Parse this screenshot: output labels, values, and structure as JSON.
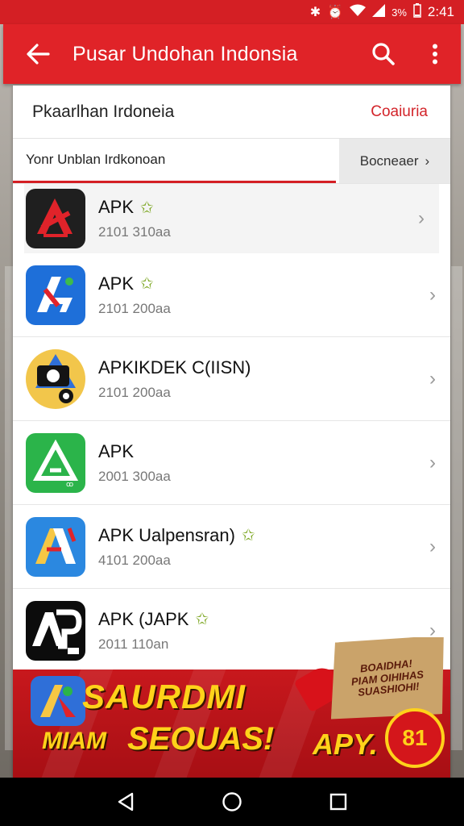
{
  "status_bar": {
    "battery": "3%",
    "time": "2:41"
  },
  "app_bar": {
    "title": "Pusar Undohan Indonsia"
  },
  "card": {
    "title": "Pkaarlhan Irdoneia",
    "action": "Coaiuria"
  },
  "search": {
    "value": "Yonr Unblan Irdkonoan",
    "button_label": "Bocneaer"
  },
  "apps": [
    {
      "name": "APK",
      "meta": "2101 310aa",
      "starred": true,
      "icon_color": "#1f1f1f"
    },
    {
      "name": "APK",
      "meta": "2101 200aa",
      "starred": true,
      "icon_color": "#1e6fd9"
    },
    {
      "name": "APKIKDEK C(IISN)",
      "meta": "2101 200aa",
      "starred": false,
      "icon_color": "#f2c64b"
    },
    {
      "name": "APK",
      "meta": "2001 300aa",
      "starred": false,
      "icon_color": "#2bb44a"
    },
    {
      "name": "APK Ualpensran)",
      "meta": "4101 200aa",
      "starred": true,
      "icon_color": "#2b88e0"
    },
    {
      "name": "APK (JAPK",
      "meta": "2011 110an",
      "starred": true,
      "icon_color": "#0c0c0c"
    }
  ],
  "promo": {
    "headline": "SAURDMI",
    "line_left": "MIAM",
    "line_right": "SEOUAS!",
    "sign_line1": "BOAIDHA!",
    "sign_line2": "PIAM OIHIHAS",
    "sign_line3": "SUASHIOHI!",
    "apy": "APY.",
    "badge": "81"
  },
  "colors": {
    "primary": "#e02328",
    "status": "#d41f24",
    "accent_star": "#7aa51e",
    "promo_yellow": "#ffd21a"
  }
}
